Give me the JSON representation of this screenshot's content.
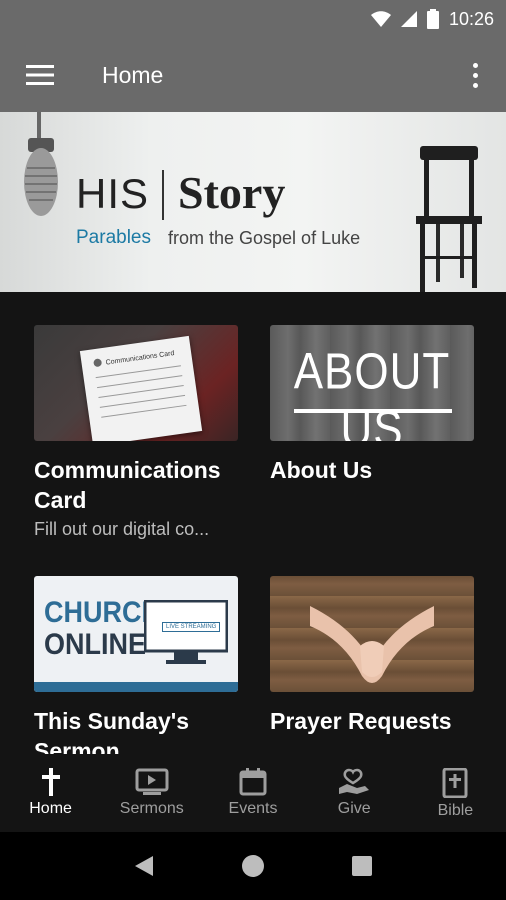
{
  "status": {
    "time": "10:26"
  },
  "appbar": {
    "title": "Home"
  },
  "banner": {
    "his": "HIS",
    "story": "Story",
    "parables": "Parables",
    "subtitle": "from the Gospel of Luke"
  },
  "cards": [
    {
      "title": "Communications Card",
      "desc": "Fill out our digital co...",
      "thumb_text": "Communications Card"
    },
    {
      "title": "About Us",
      "desc": "",
      "thumb_text": "ABOUT US"
    },
    {
      "title": "This Sunday's Sermon",
      "desc": "",
      "thumb_text_1": "CHURCH",
      "thumb_text_2": "ONLINE",
      "thumb_badge": "LIVE STREAMING"
    },
    {
      "title": "Prayer Requests",
      "desc": ""
    }
  ],
  "nav": [
    {
      "label": "Home",
      "icon": "cross-icon",
      "active": true
    },
    {
      "label": "Sermons",
      "icon": "video-icon"
    },
    {
      "label": "Events",
      "icon": "calendar-icon"
    },
    {
      "label": "Give",
      "icon": "give-heart-icon"
    },
    {
      "label": "Bible",
      "icon": "bible-icon"
    }
  ]
}
